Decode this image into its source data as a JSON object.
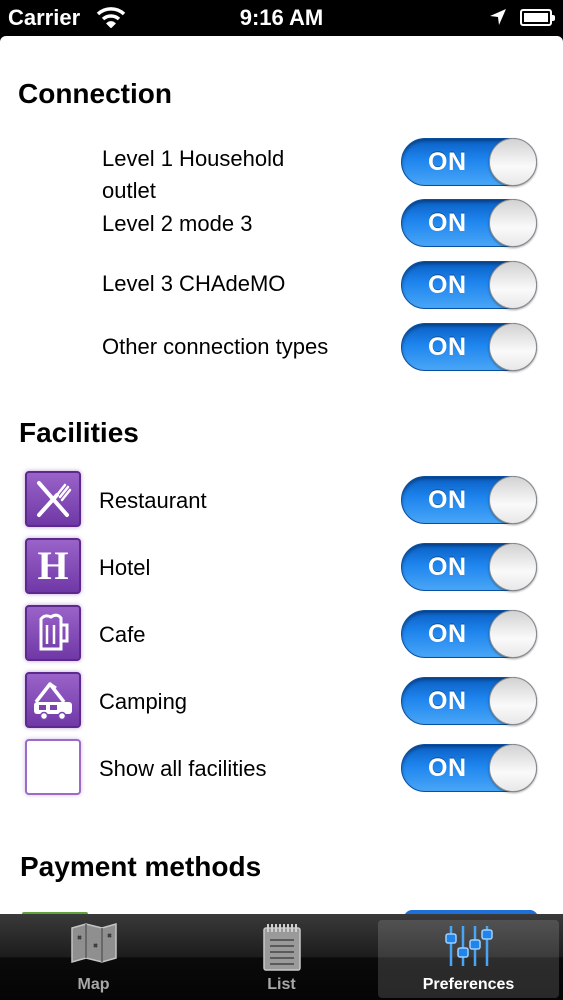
{
  "status_bar": {
    "carrier": "Carrier",
    "time": "9:16 AM"
  },
  "sections": {
    "connection": {
      "title": "Connection",
      "items": [
        {
          "label_line1": "Level 1 Household",
          "label_line2": "outlet",
          "toggle": "ON"
        },
        {
          "label": "Level 2 mode 3",
          "toggle": "ON"
        },
        {
          "label": "Level 3 CHAdeMO",
          "toggle": "ON"
        },
        {
          "label": "Other connection types",
          "toggle": "ON"
        }
      ]
    },
    "facilities": {
      "title": "Facilities",
      "items": [
        {
          "label": "Restaurant",
          "icon": "restaurant-icon",
          "toggle": "ON"
        },
        {
          "label": "Hotel",
          "icon": "hotel-icon",
          "icon_letter": "H",
          "toggle": "ON"
        },
        {
          "label": "Cafe",
          "icon": "cafe-icon",
          "toggle": "ON"
        },
        {
          "label": "Camping",
          "icon": "camping-icon",
          "toggle": "ON"
        },
        {
          "label": "Show all facilities",
          "icon": "blank-icon",
          "toggle": "ON"
        }
      ]
    },
    "payment": {
      "title": "Payment methods"
    }
  },
  "tab_bar": {
    "tabs": [
      {
        "label": "Map",
        "icon": "map-icon",
        "active": false
      },
      {
        "label": "List",
        "icon": "list-icon",
        "active": false
      },
      {
        "label": "Preferences",
        "icon": "preferences-icon",
        "active": true
      }
    ]
  },
  "colors": {
    "toggle_on": "#1e85ee",
    "facility_icon": "#7a45b0",
    "active_tab": "#ffffff"
  }
}
